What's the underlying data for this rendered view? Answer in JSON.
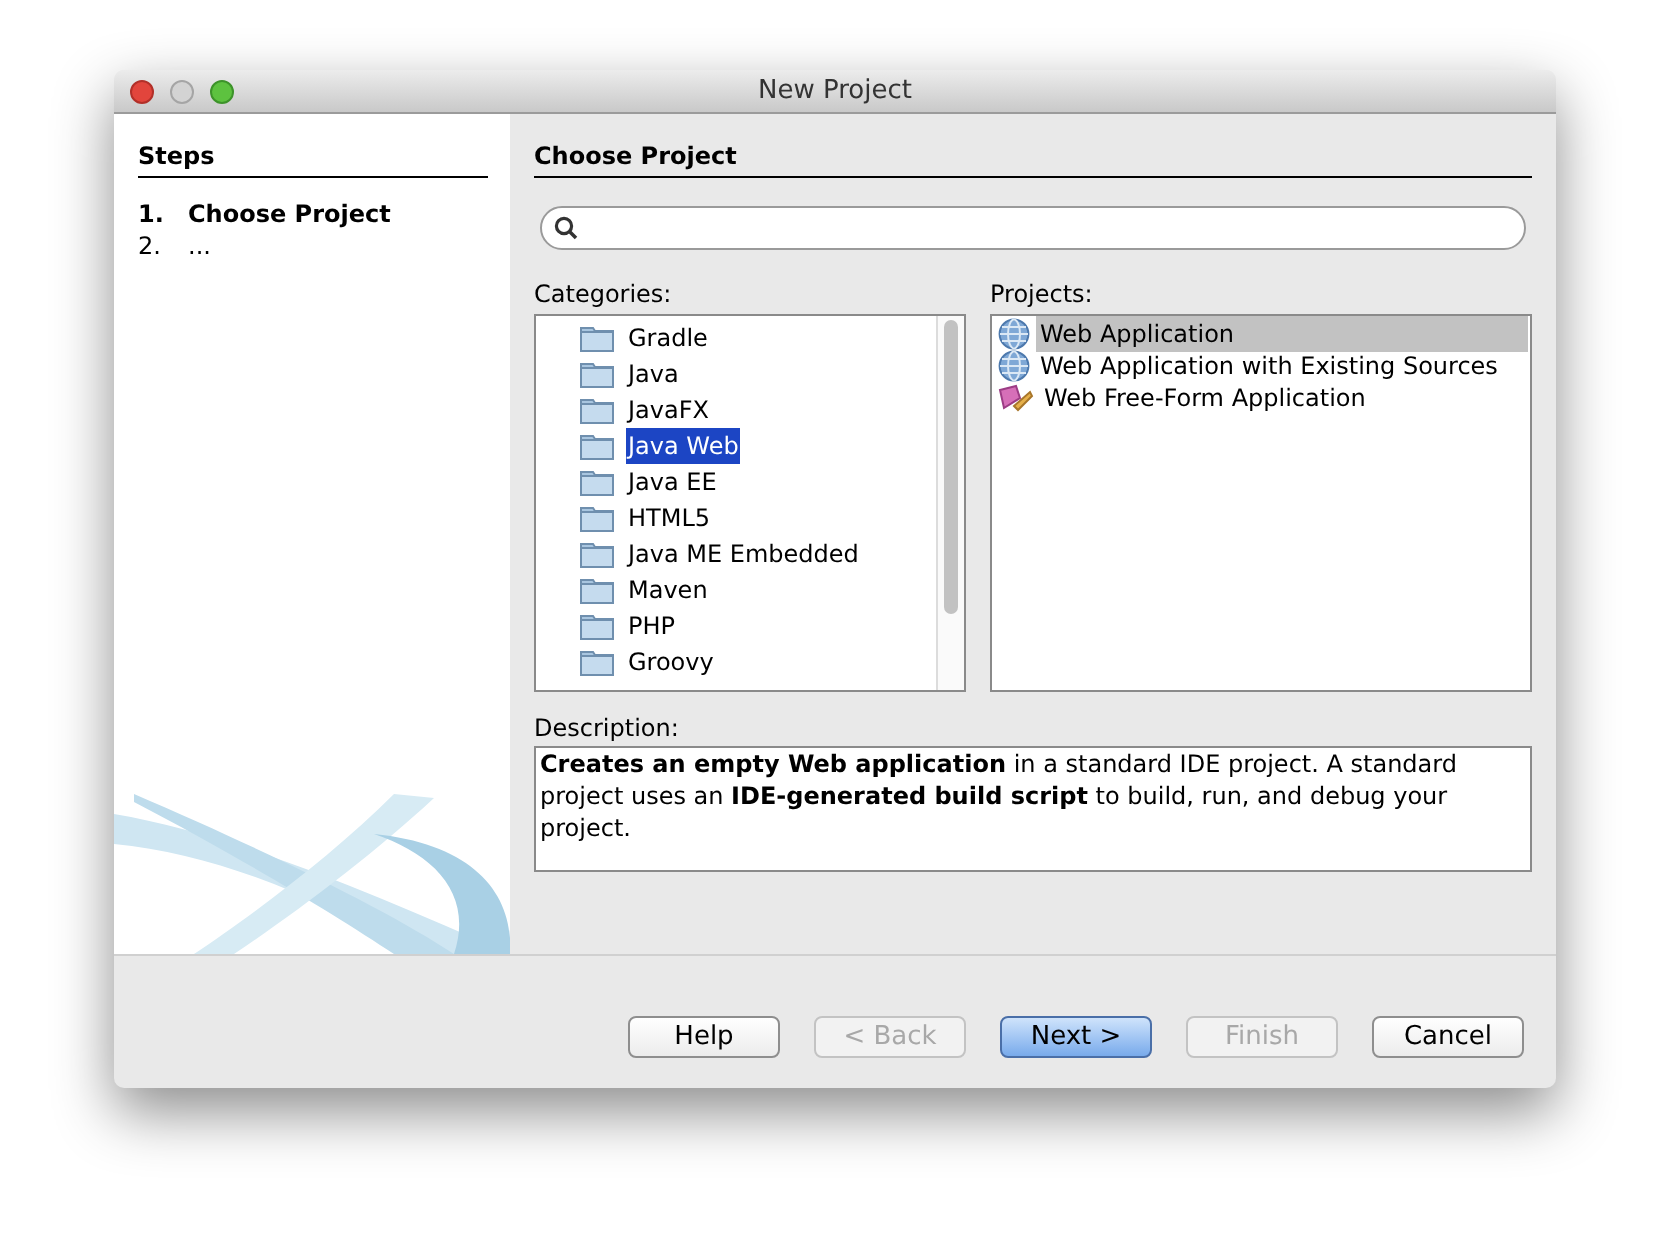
{
  "window": {
    "title": "New Project"
  },
  "steps": {
    "title": "Steps",
    "items": [
      {
        "number": "1.",
        "label": "Choose Project",
        "selected": true
      },
      {
        "number": "2.",
        "label": "...",
        "selected": false
      }
    ]
  },
  "panel": {
    "title": "Choose Project"
  },
  "categories": {
    "label": "Categories:",
    "items": [
      {
        "label": "Gradle",
        "selected": false
      },
      {
        "label": "Java",
        "selected": false
      },
      {
        "label": "JavaFX",
        "selected": false
      },
      {
        "label": "Java Web",
        "selected": true
      },
      {
        "label": "Java EE",
        "selected": false
      },
      {
        "label": "HTML5",
        "selected": false
      },
      {
        "label": "Java ME Embedded",
        "selected": false
      },
      {
        "label": "Maven",
        "selected": false
      },
      {
        "label": "PHP",
        "selected": false
      },
      {
        "label": "Groovy",
        "selected": false
      }
    ]
  },
  "projects": {
    "label": "Projects:",
    "items": [
      {
        "label": "Web Application",
        "kind": "globe",
        "selected": true
      },
      {
        "label": "Web Application with Existing Sources",
        "kind": "globe",
        "selected": false
      },
      {
        "label": "Web Free-Form Application",
        "kind": "freeform",
        "selected": false
      }
    ]
  },
  "description": {
    "label": "Description:",
    "text": "**Creates an empty Web application** in a standard IDE project. A standard project uses an **IDE-generated build script** to build, run, and debug your project."
  },
  "buttons": [
    {
      "label": "Help",
      "kind": "normal",
      "disabled": false
    },
    {
      "label": "< Back",
      "kind": "normal",
      "disabled": true
    },
    {
      "label": "Next >",
      "kind": "default",
      "disabled": false
    },
    {
      "label": "Finish",
      "kind": "normal",
      "disabled": true
    },
    {
      "label": "Cancel",
      "kind": "normal",
      "disabled": false
    }
  ]
}
